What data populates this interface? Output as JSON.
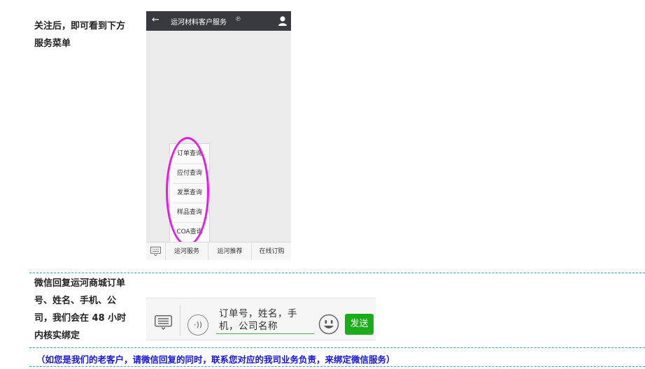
{
  "section1": {
    "instruction_lines": [
      "关注后，即可看到下方",
      "服务菜单"
    ]
  },
  "phone": {
    "header": {
      "title": "运河材料客户服务"
    },
    "menu_tabs": [
      "运河服务",
      "运河推荐",
      "在线订购"
    ],
    "submenu_items": [
      "订单查询",
      "应付查询",
      "发票查询",
      "样品查询",
      "COA查询"
    ],
    "highlight_color": "#e31be3"
  },
  "section2": {
    "instruction_lines": [
      "微信回复运河商城订单",
      "号、姓名、手机、公",
      "司，我们会在 48 小时",
      "内核实绑定"
    ]
  },
  "chat_input": {
    "text_lines": [
      "订单号，姓名，手",
      "机，公司名称"
    ],
    "send_label": "发送"
  },
  "footer_note": "（如您是我们的老客户，请微信回复的同时，联系您对应的我司业务负责，来绑定微信服务）",
  "colors": {
    "dashed_line": "#3b9fc2",
    "note_text": "#1515d8",
    "send_button": "#1aad19",
    "header_bar": "#393a3f"
  }
}
